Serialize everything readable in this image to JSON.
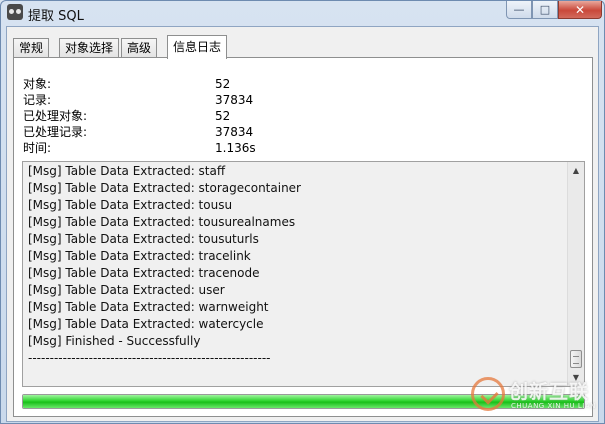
{
  "window": {
    "title": "提取 SQL",
    "controls": {
      "minimize": "—",
      "maximize": "□",
      "close": "✕"
    }
  },
  "tabs": [
    {
      "label": "常规",
      "active": false
    },
    {
      "label": "对象选择",
      "active": false
    },
    {
      "label": "高级",
      "active": false
    },
    {
      "label": "信息日志",
      "active": true
    }
  ],
  "stats": [
    {
      "label": "对象:",
      "value": "52"
    },
    {
      "label": "记录:",
      "value": "37834"
    },
    {
      "label": "已处理对象:",
      "value": "52"
    },
    {
      "label": "已处理记录:",
      "value": "37834"
    },
    {
      "label": "时间:",
      "value": "1.136s"
    }
  ],
  "log": {
    "lines": [
      "[Msg] Table Data Extracted: staff",
      "[Msg] Table Data Extracted: storagecontainer",
      "[Msg] Table Data Extracted: tousu",
      "[Msg] Table Data Extracted: tousurealnames",
      "[Msg] Table Data Extracted: tousuturls",
      "[Msg] Table Data Extracted: tracelink",
      "[Msg] Table Data Extracted: tracenode",
      "[Msg] Table Data Extracted: user",
      "[Msg] Table Data Extracted: warnweight",
      "[Msg] Table Data Extracted: watercycle",
      "[Msg] Finished - Successfully",
      "--------------------------------------------------------"
    ]
  },
  "progress": {
    "percent": 100,
    "color": "#22c922"
  },
  "watermark": {
    "text_cn": "创新互联",
    "text_en": "CHUANG XIN HU LIAN"
  }
}
